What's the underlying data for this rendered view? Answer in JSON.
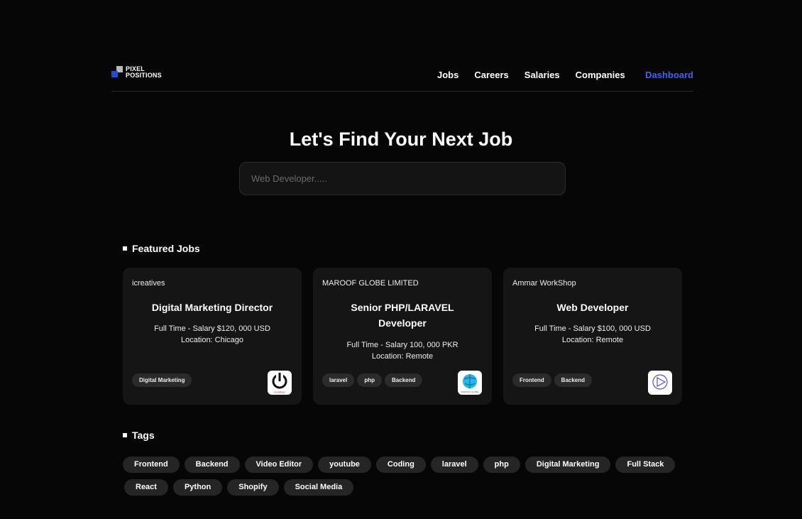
{
  "nav": {
    "logo_line1": "PIXEL",
    "logo_line2": "POSITIONS",
    "links": [
      "Jobs",
      "Careers",
      "Salaries",
      "Companies"
    ],
    "dashboard": "Dashboard"
  },
  "hero": {
    "title": "Let's Find Your Next Job",
    "search_placeholder": "Web Developer....."
  },
  "featured": {
    "heading": "Featured Jobs",
    "jobs": [
      {
        "company": "icreatives",
        "title": "Digital Marketing Director",
        "salary": "Full Time - Salary $120, 000 USD",
        "location": "Location: Chicago",
        "tags": [
          "Digital Marketing"
        ],
        "logo_text": "creatives"
      },
      {
        "company": "MAROOF GLOBE LIMITED",
        "title": "Senior PHP/LARAVEL Developer",
        "salary": "Full Time - Salary 100, 000 PKR",
        "location": "Location: Remote",
        "tags": [
          "laravel",
          "php",
          "Backend"
        ],
        "logo_text": "MAROOF GLOBE"
      },
      {
        "company": "Ammar WorkShop",
        "title": "Web Developer",
        "salary": "Full Time - Salary $100, 000 USD",
        "location": "Location: Remote",
        "tags": [
          "Frontend",
          "Backend"
        ],
        "logo_text": ""
      }
    ]
  },
  "tags": {
    "heading": "Tags",
    "row1": [
      "Frontend",
      "Backend",
      "Video Editor",
      "youtube",
      "Coding",
      "laravel",
      "php",
      "Digital Marketing",
      "Full Stack"
    ],
    "row2": [
      "React",
      "Python",
      "Shopify",
      "Social Media"
    ]
  },
  "colors": {
    "background": "#060606",
    "card": "#151515",
    "accent": "#3b63f6"
  }
}
